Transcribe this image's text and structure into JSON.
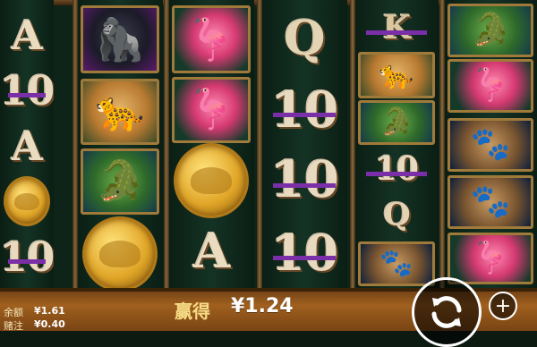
{
  "reels": [
    [
      {
        "kind": "letter",
        "text": "A"
      },
      {
        "kind": "letter",
        "text": "10"
      },
      {
        "kind": "letter",
        "text": "A"
      },
      {
        "kind": "coin",
        "name": "rhino-coin"
      },
      {
        "kind": "letter",
        "text": "10"
      }
    ],
    [
      {
        "kind": "animal",
        "name": "gorilla",
        "glyph": "🦍"
      },
      {
        "kind": "animal",
        "name": "cheetah",
        "glyph": "🐆"
      },
      {
        "kind": "animal",
        "name": "crocodile",
        "glyph": "🐊"
      },
      {
        "kind": "coin",
        "name": "rhino-coin"
      }
    ],
    [
      {
        "kind": "animal",
        "name": "flamingo",
        "glyph": "🦩"
      },
      {
        "kind": "animal",
        "name": "flamingo",
        "glyph": "🦩"
      },
      {
        "kind": "coin",
        "name": "rhino-coin"
      },
      {
        "kind": "letter",
        "text": "A"
      }
    ],
    [
      {
        "kind": "letter",
        "text": "Q"
      },
      {
        "kind": "letter",
        "text": "10"
      },
      {
        "kind": "letter",
        "text": "10"
      },
      {
        "kind": "letter",
        "text": "10"
      }
    ],
    [
      {
        "kind": "letter",
        "text": "K"
      },
      {
        "kind": "animal",
        "name": "cheetah",
        "glyph": "🐆"
      },
      {
        "kind": "animal",
        "name": "crocodile",
        "glyph": "🐊"
      },
      {
        "kind": "letter",
        "text": "10"
      },
      {
        "kind": "letter",
        "text": "Q"
      },
      {
        "kind": "animal",
        "name": "hyena",
        "glyph": "🐾"
      }
    ],
    [
      {
        "kind": "animal",
        "name": "crocodile",
        "glyph": "🐊"
      },
      {
        "kind": "animal",
        "name": "flamingo",
        "glyph": "🦩"
      },
      {
        "kind": "animal",
        "name": "hyena",
        "glyph": "🐾"
      },
      {
        "kind": "animal",
        "name": "hyena",
        "glyph": "🐾"
      },
      {
        "kind": "animal",
        "name": "flamingo",
        "glyph": "🦩"
      }
    ]
  ],
  "bottom": {
    "balance_label": "余额",
    "balance_value": "¥1.61",
    "bet_label": "赌注",
    "bet_value": "¥0.40",
    "win_label": "赢得",
    "win_value": "¥1.24"
  },
  "controls": {
    "spin_icon": "refresh-icon",
    "plus_icon": "plus-icon",
    "plus_glyph": "+"
  }
}
